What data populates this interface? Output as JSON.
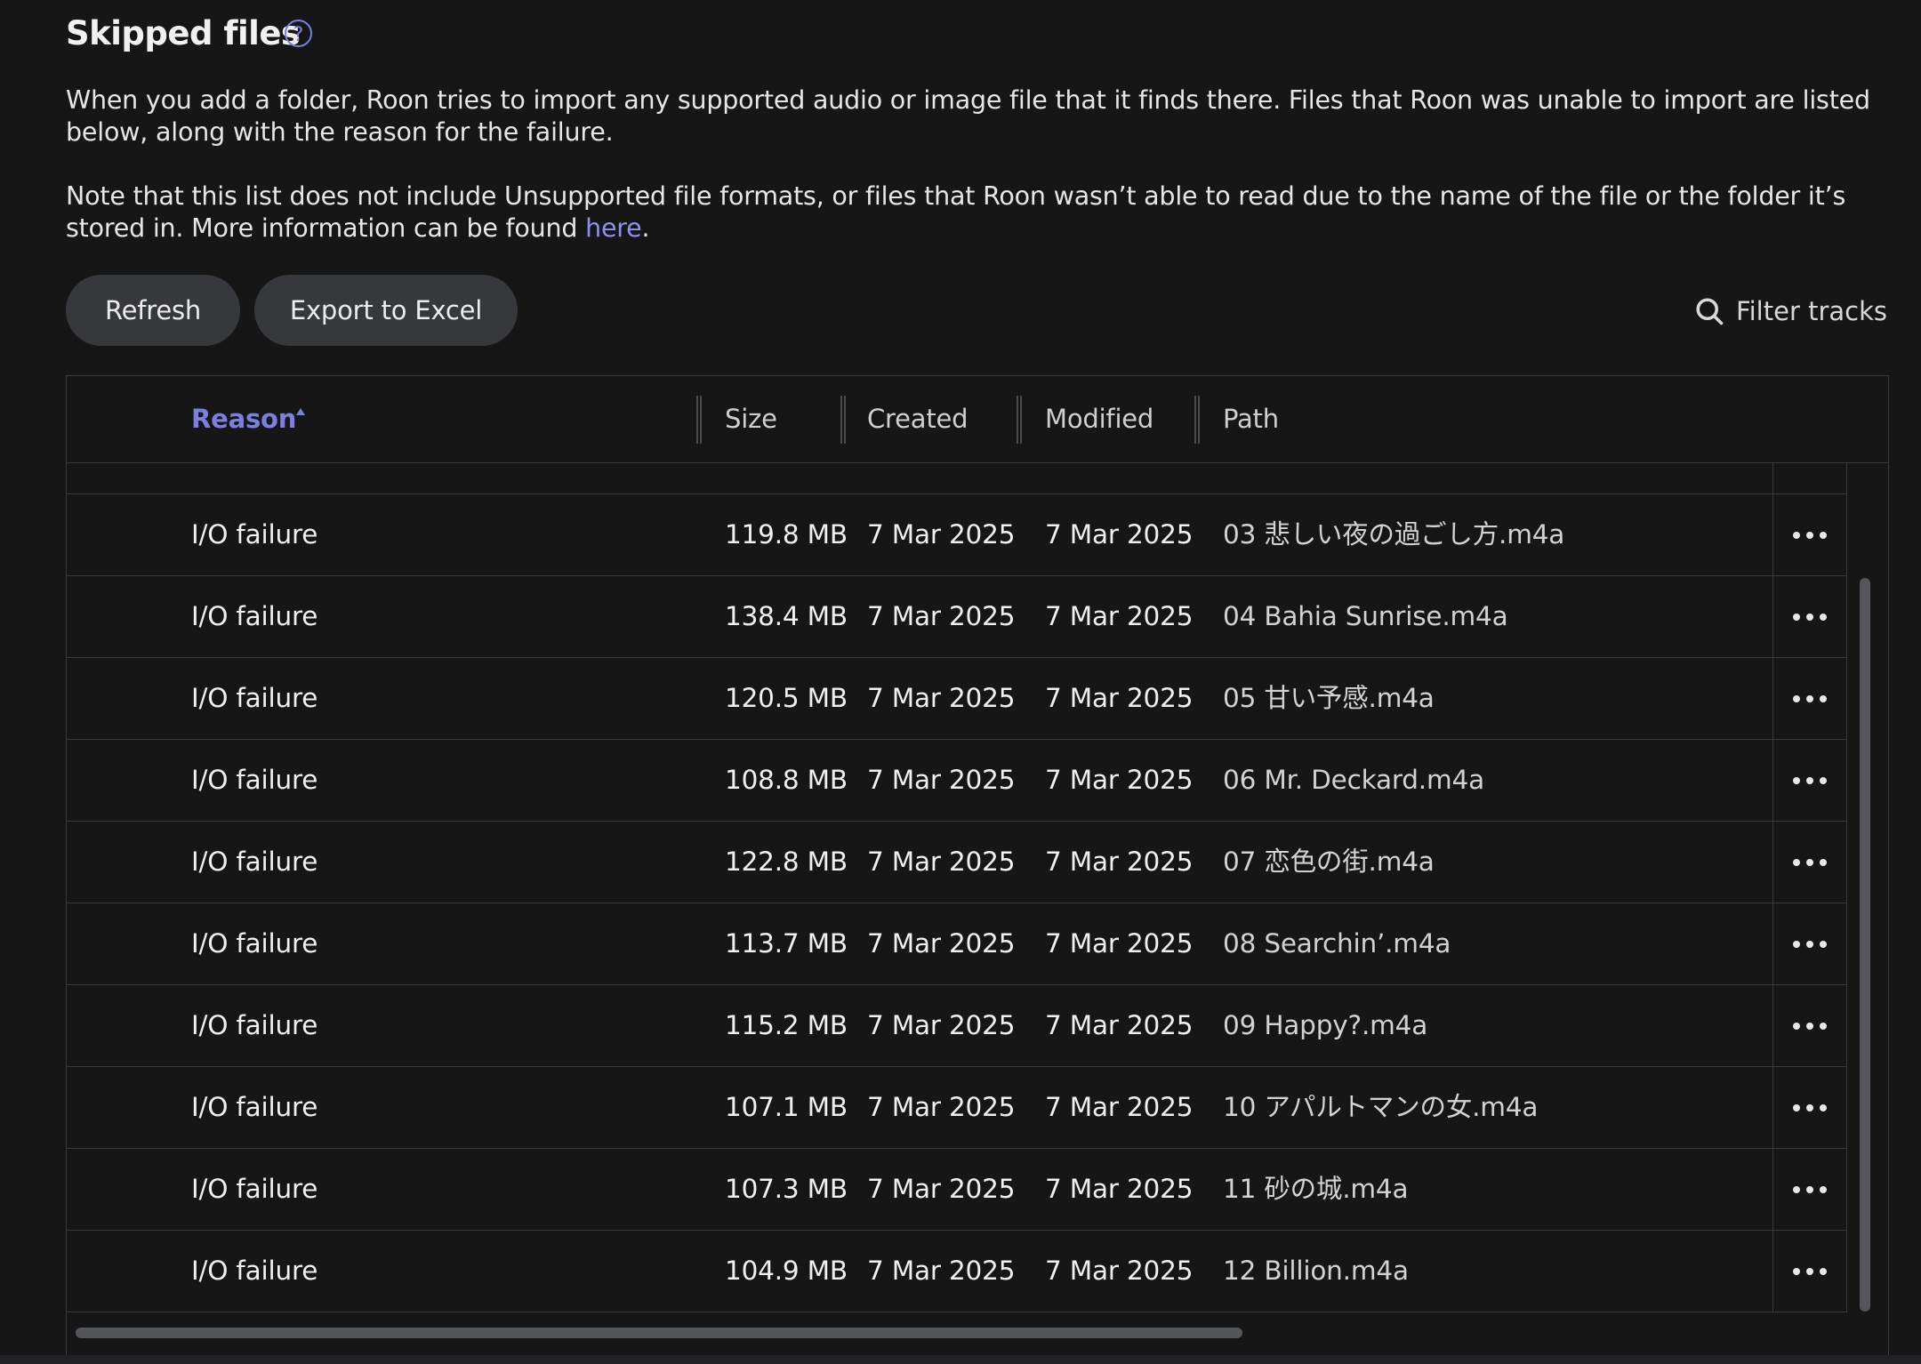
{
  "header": {
    "title": "Skipped files",
    "help_icon": "question-circle-icon"
  },
  "description": {
    "paragraph1": "When you add a folder, Roon tries to import any supported audio or image file that it finds there. Files that Roon was unable to import are listed below, along with the reason for the failure.",
    "paragraph2_text": "Note that this list does not include Unsupported file formats, or files that Roon wasn’t able to read due to the name of the file or the folder it’s stored in. More information can be found ",
    "paragraph2_link": "here",
    "paragraph2_end": "."
  },
  "toolbar": {
    "refresh_label": "Refresh",
    "export_label": "Export to Excel",
    "filter_label": "Filter tracks",
    "filter_icon": "search-icon"
  },
  "table": {
    "columns": {
      "reason": "Reason",
      "size": "Size",
      "created": "Created",
      "modified": "Modified",
      "path": "Path"
    },
    "sort_column": "Reason",
    "sort_direction": "ascending",
    "rows": [
      {
        "reason": "I/O failure",
        "size": "119.8 MB",
        "created": "7 Mar 2025",
        "modified": "7 Mar 2025",
        "path": "03 悲しい夜の過ごし方.m4a"
      },
      {
        "reason": "I/O failure",
        "size": "138.4 MB",
        "created": "7 Mar 2025",
        "modified": "7 Mar 2025",
        "path": "04 Bahia Sunrise.m4a"
      },
      {
        "reason": "I/O failure",
        "size": "120.5 MB",
        "created": "7 Mar 2025",
        "modified": "7 Mar 2025",
        "path": "05 甘い予感.m4a"
      },
      {
        "reason": "I/O failure",
        "size": "108.8 MB",
        "created": "7 Mar 2025",
        "modified": "7 Mar 2025",
        "path": "06 Mr. Deckard.m4a"
      },
      {
        "reason": "I/O failure",
        "size": "122.8 MB",
        "created": "7 Mar 2025",
        "modified": "7 Mar 2025",
        "path": "07 恋色の街.m4a"
      },
      {
        "reason": "I/O failure",
        "size": "113.7 MB",
        "created": "7 Mar 2025",
        "modified": "7 Mar 2025",
        "path": "08 Searchin’.m4a"
      },
      {
        "reason": "I/O failure",
        "size": "115.2 MB",
        "created": "7 Mar 2025",
        "modified": "7 Mar 2025",
        "path": "09 Happy?.m4a"
      },
      {
        "reason": "I/O failure",
        "size": "107.1 MB",
        "created": "7 Mar 2025",
        "modified": "7 Mar 2025",
        "path": "10 アパルトマンの女.m4a"
      },
      {
        "reason": "I/O failure",
        "size": "107.3 MB",
        "created": "7 Mar 2025",
        "modified": "7 Mar 2025",
        "path": "11 砂の城.m4a"
      },
      {
        "reason": "I/O failure",
        "size": "104.9 MB",
        "created": "7 Mar 2025",
        "modified": "7 Mar 2025",
        "path": "12 Billion.m4a"
      }
    ],
    "row_menu_icon": "more-horizontal-icon"
  },
  "colors": {
    "background": "#161617",
    "accent": "#7b7fe0",
    "button_bg": "#37383b"
  }
}
